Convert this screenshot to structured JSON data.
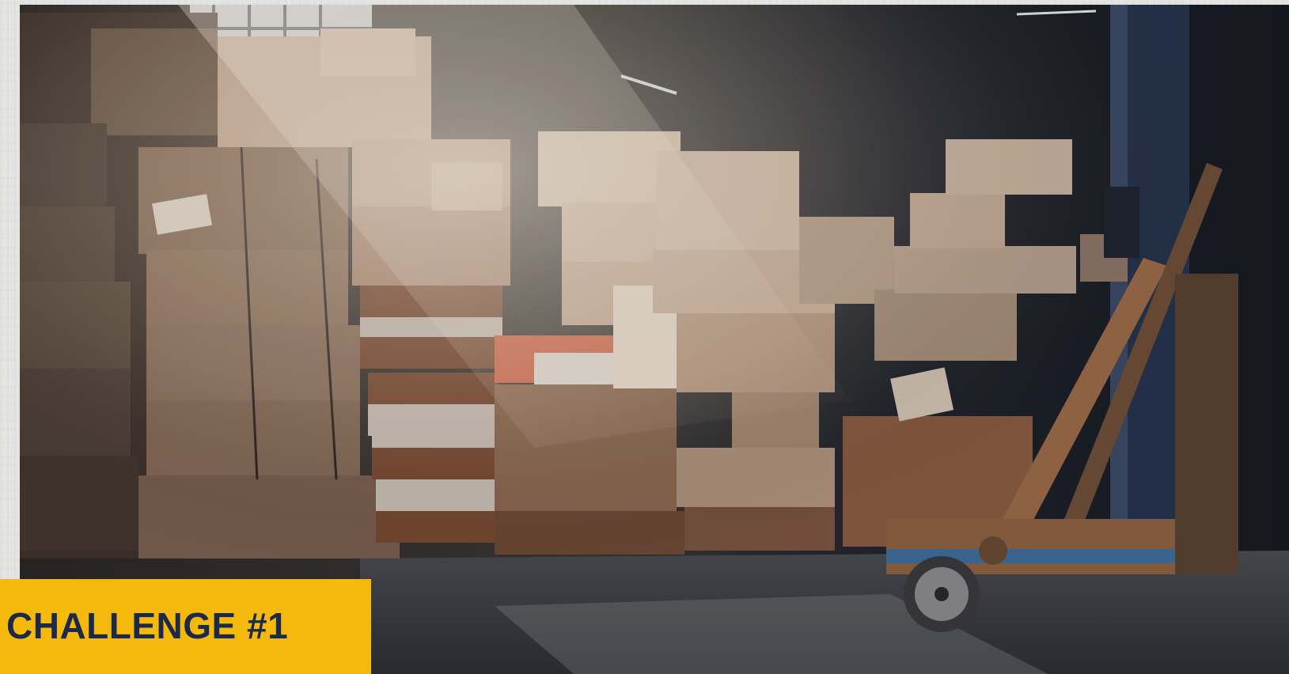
{
  "hero": {
    "image_name": "warehouse-boxes-forklift-photo"
  },
  "badge": {
    "label": "CHALLENGE #1",
    "background_color": "#f5b80c",
    "text_color": "#1c2a4a"
  }
}
